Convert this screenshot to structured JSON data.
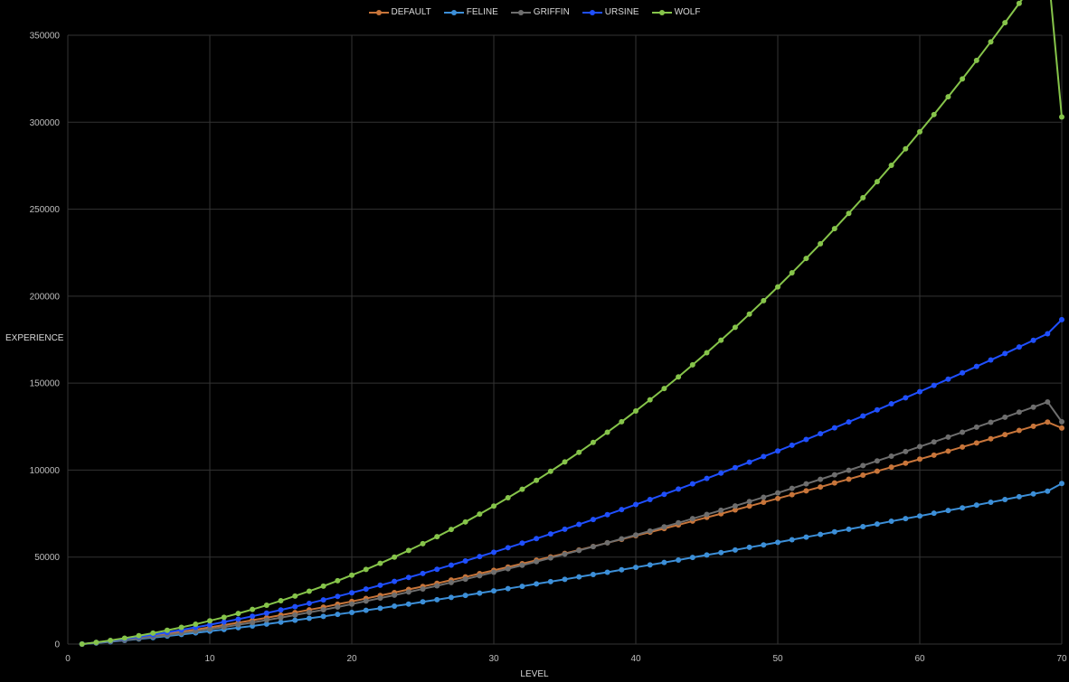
{
  "chart_data": {
    "type": "line",
    "xlabel": "LEVEL",
    "ylabel": "EXPERIENCE",
    "xlim": [
      0,
      70
    ],
    "ylim": [
      0,
      350000
    ],
    "x_ticks": [
      "0",
      "10",
      "20",
      "30",
      "40",
      "50",
      "60",
      "70"
    ],
    "y_ticks": [
      "0",
      "50000",
      "100000",
      "150000",
      "200000",
      "250000",
      "300000",
      "350000"
    ],
    "grid": true,
    "legend_position": "top-center",
    "x": [
      1,
      2,
      3,
      4,
      5,
      6,
      7,
      8,
      9,
      10,
      11,
      12,
      13,
      14,
      15,
      16,
      17,
      18,
      19,
      20,
      21,
      22,
      23,
      24,
      25,
      26,
      27,
      28,
      29,
      30,
      31,
      32,
      33,
      34,
      35,
      36,
      37,
      38,
      39,
      40,
      41,
      42,
      43,
      44,
      45,
      46,
      47,
      48,
      49,
      50,
      51,
      52,
      53,
      54,
      55,
      56,
      57,
      58,
      59,
      60,
      61,
      62,
      63,
      64,
      65,
      66,
      67,
      68,
      69,
      70
    ],
    "series": [
      {
        "name": "DEFAULT",
        "color": "#c8753a",
        "values": [
          0,
          800,
          1700,
          2700,
          3700,
          4800,
          5900,
          7100,
          8300,
          9600,
          10900,
          12300,
          13700,
          15100,
          16600,
          18100,
          19700,
          21200,
          22900,
          24500,
          26200,
          27900,
          29600,
          31400,
          33100,
          34900,
          36800,
          38600,
          40500,
          42400,
          44300,
          46200,
          48200,
          50100,
          52100,
          54100,
          56100,
          58200,
          60200,
          62300,
          64300,
          66400,
          68500,
          70700,
          72800,
          74900,
          77100,
          79300,
          81500,
          83700,
          85900,
          88100,
          90300,
          92600,
          94800,
          97100,
          99400,
          101700,
          104000,
          106300,
          108600,
          110900,
          113300,
          115600,
          118000,
          120400,
          122800,
          125200,
          127600,
          124200
        ]
      },
      {
        "name": "FELINE",
        "color": "#3c8fd8",
        "values": [
          0,
          600,
          1300,
          2100,
          2900,
          3700,
          4600,
          5500,
          6400,
          7400,
          8400,
          9400,
          10400,
          11500,
          12600,
          13700,
          14800,
          15900,
          17100,
          18200,
          19400,
          20600,
          21800,
          23000,
          24300,
          25500,
          26800,
          28000,
          29300,
          30600,
          31900,
          33200,
          34600,
          35900,
          37200,
          38600,
          40000,
          41300,
          42700,
          44100,
          45500,
          46900,
          48300,
          49800,
          51200,
          52600,
          54100,
          55600,
          57000,
          58500,
          60000,
          61500,
          63000,
          64500,
          66000,
          67500,
          69000,
          70600,
          72100,
          73600,
          75200,
          76800,
          78300,
          79900,
          81500,
          83100,
          84700,
          86300,
          87900,
          92300
        ]
      },
      {
        "name": "GRIFFIN",
        "color": "#6e6e6e",
        "values": [
          0,
          700,
          1500,
          2300,
          3200,
          4200,
          5200,
          6300,
          7400,
          8600,
          9800,
          11100,
          12400,
          13800,
          15200,
          16700,
          18200,
          19700,
          21300,
          23000,
          24700,
          26400,
          28100,
          29900,
          31700,
          33500,
          35400,
          37300,
          39300,
          41300,
          43300,
          45300,
          47400,
          49500,
          51700,
          53800,
          56000,
          58200,
          60500,
          62700,
          65000,
          67400,
          69700,
          72100,
          74500,
          76900,
          79400,
          81900,
          84400,
          86900,
          89500,
          92100,
          94700,
          97300,
          99900,
          102600,
          105300,
          108000,
          110700,
          113500,
          116200,
          119000,
          121800,
          124700,
          127500,
          130400,
          133300,
          136200,
          139200,
          127800
        ]
      },
      {
        "name": "URSINE",
        "color": "#1f4fff",
        "values": [
          0,
          900,
          1900,
          3000,
          4200,
          5400,
          6700,
          8100,
          9600,
          11100,
          12700,
          14300,
          16000,
          17800,
          19600,
          21500,
          23400,
          25400,
          27400,
          29500,
          31600,
          33800,
          36000,
          38300,
          40600,
          43000,
          45400,
          47800,
          50300,
          52800,
          55400,
          58000,
          60600,
          63300,
          66000,
          68800,
          71600,
          74400,
          77300,
          80200,
          83100,
          86100,
          89100,
          92100,
          95200,
          98300,
          101400,
          104600,
          107800,
          111000,
          114300,
          117600,
          120900,
          124300,
          127700,
          131100,
          134600,
          138100,
          141600,
          145100,
          148700,
          152300,
          155900,
          159600,
          163300,
          167000,
          170800,
          174600,
          178400,
          186500
        ]
      },
      {
        "name": "WOLF",
        "color": "#86c44a",
        "values": [
          0,
          1000,
          2100,
          3400,
          4800,
          6300,
          7900,
          9600,
          11400,
          13400,
          15400,
          17600,
          19900,
          22300,
          24900,
          27600,
          30400,
          33300,
          36400,
          39600,
          42900,
          46400,
          50000,
          53800,
          57700,
          61700,
          65900,
          70200,
          74700,
          79300,
          84100,
          89000,
          94100,
          99300,
          104700,
          110200,
          115900,
          121800,
          127800,
          134000,
          140400,
          146900,
          153600,
          160500,
          167500,
          174700,
          182100,
          189700,
          197400,
          205300,
          213400,
          221700,
          230100,
          238800,
          247600,
          256600,
          265800,
          275200,
          284700,
          294500,
          304400,
          314600,
          324900,
          335500,
          346200,
          357200,
          368300,
          379700,
          391200,
          303000
        ]
      }
    ]
  }
}
